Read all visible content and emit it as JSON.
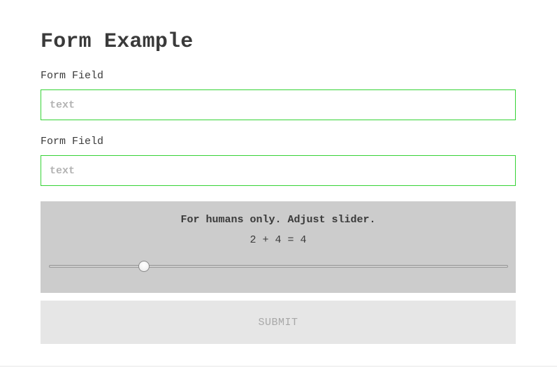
{
  "form": {
    "title": "Form Example",
    "fields": [
      {
        "label": "Form Field",
        "value": "",
        "placeholder": "text"
      },
      {
        "label": "Form Field",
        "value": "",
        "placeholder": "text"
      }
    ],
    "input_border_color": "#36d336"
  },
  "captcha": {
    "prompt": "For humans only. Adjust slider.",
    "equation": "2 + 4 = 4",
    "slider": {
      "min": 0,
      "max": 20,
      "value": 4
    },
    "background_color": "#cccccc"
  },
  "submit": {
    "label": "SUBMIT",
    "background_color": "#e6e6e6"
  }
}
